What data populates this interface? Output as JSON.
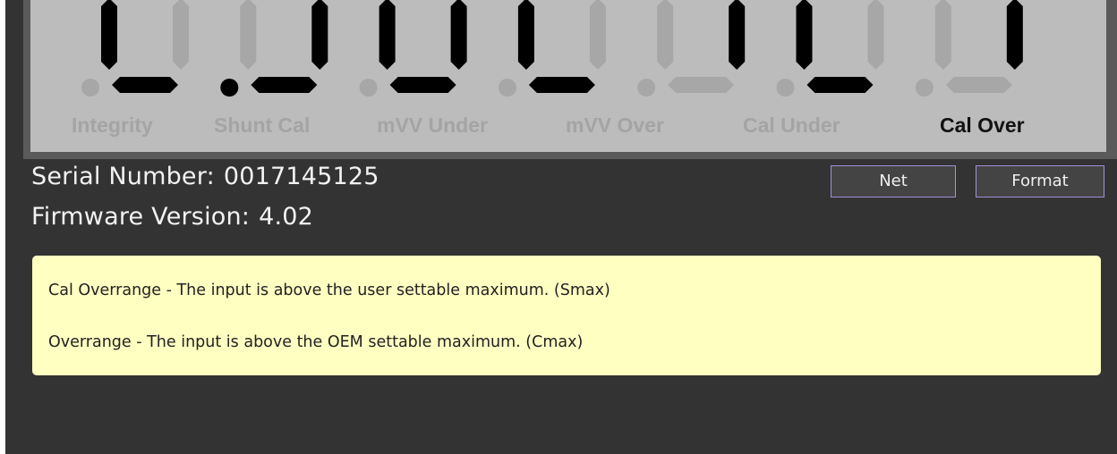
{
  "display": {
    "digits": [
      {
        "segments": "def",
        "dp": false
      },
      {
        "segments": "bcd",
        "dp": true
      },
      {
        "segments": "bcdef",
        "dp": false
      },
      {
        "segments": "def",
        "dp": false
      },
      {
        "segments": "bc",
        "dp": false
      },
      {
        "segments": "def",
        "dp": false
      },
      {
        "segments": "bc",
        "dp": false
      }
    ],
    "annunciators": [
      {
        "label": "Integrity",
        "active": false
      },
      {
        "label": "Shunt Cal",
        "active": false
      },
      {
        "label": "mVV Under",
        "active": false
      },
      {
        "label": "mVV Over",
        "active": false
      },
      {
        "label": "Cal Under",
        "active": false
      },
      {
        "label": "Cal Over",
        "active": true
      }
    ],
    "colors": {
      "lcd_bg": "#bcbcbc",
      "segment_on": "#000000",
      "segment_off": "#a7a7a7"
    }
  },
  "info": {
    "serial_label": "Serial Number:",
    "serial_value": "0017145125",
    "firmware_label": "Firmware Version:",
    "firmware_value": "4.02"
  },
  "buttons": {
    "net": "Net",
    "format": "Format"
  },
  "message": {
    "line1": "Cal Overrange - The input is above the user settable maximum. (Smax)",
    "line2": "Overrange - The input is above the OEM settable maximum. (Cmax)"
  },
  "colors": {
    "background": "#333333",
    "message_bg": "#ffffc2",
    "button_border": "#a48fd6"
  }
}
